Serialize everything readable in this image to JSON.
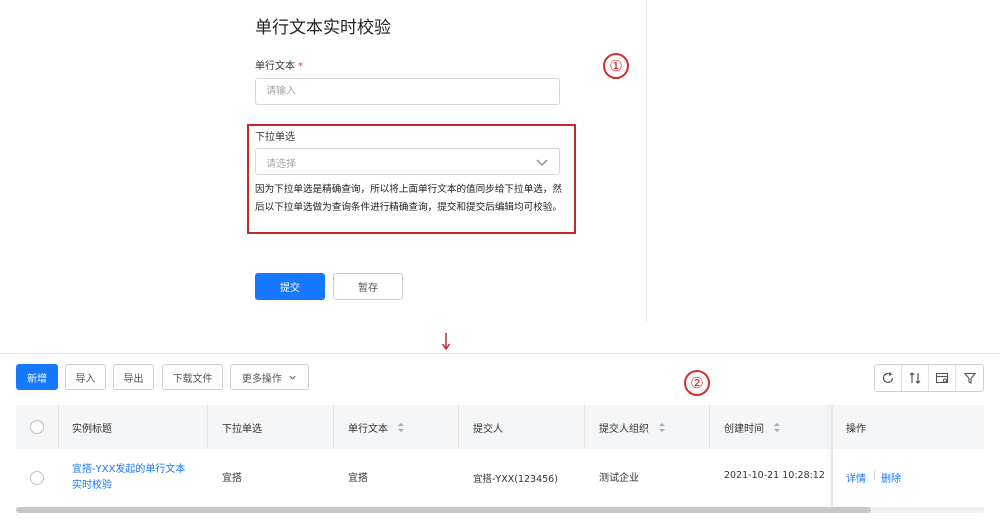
{
  "form": {
    "title": "单行文本实时校验",
    "text_field": {
      "label": "单行文本",
      "required_mark": "*",
      "placeholder": "请输入"
    },
    "select_field": {
      "label": "下拉单选",
      "placeholder": "请选择"
    },
    "description": "因为下拉单选是精确查询，所以将上面单行文本的值同步给下拉单选，然后以下拉单选做为查询条件进行精确查询，提交和提交后编辑均可校验。",
    "submit_label": "提交",
    "save_draft_label": "暂存"
  },
  "annotations": {
    "marker_1": "①",
    "marker_2": "②"
  },
  "toolbar": {
    "add_label": "新增",
    "import_label": "导入",
    "export_label": "导出",
    "download_label": "下载文件",
    "more_label": "更多操作",
    "icons": [
      "refresh-icon",
      "column-sort-icon",
      "column-settings-icon",
      "filter-icon"
    ]
  },
  "table": {
    "columns": [
      "实例标题",
      "下拉单选",
      "单行文本",
      "提交人",
      "提交人组织",
      "创建时间",
      "操作"
    ],
    "rows": [
      {
        "title_line1": "宜搭-YXX发起的单行文本",
        "title_line2": "实时校验",
        "select": "宜搭",
        "text": "宜搭",
        "submitter": "宜搭-YXX(123456)",
        "org": "测试企业",
        "created": "2021-10-21 10:28:12",
        "action_detail": "详情",
        "action_delete": "删除"
      }
    ]
  },
  "colors": {
    "primary": "#1677ff",
    "highlight": "#c62828"
  }
}
